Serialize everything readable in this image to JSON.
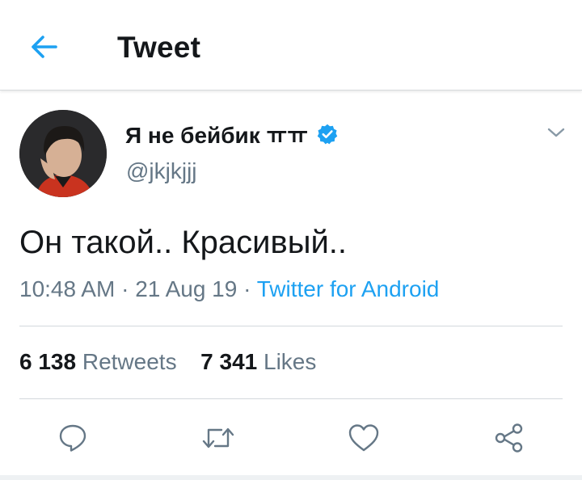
{
  "header": {
    "title": "Tweet",
    "back_icon": "arrow-left-icon",
    "accent": "#1da1f2"
  },
  "tweet": {
    "author": {
      "display_name": "Я не бейбик ㅠㅠ",
      "handle": "@jkjkjjj",
      "verified": true,
      "verified_color": "#1da1f2"
    },
    "text": "Он такой.. Красивый..",
    "time": "10:48 AM",
    "date": "21 Aug 19",
    "separator": "·",
    "source": "Twitter for Android",
    "stats": {
      "retweets_count": "6 138",
      "retweets_label": "Retweets",
      "likes_count": "7 341",
      "likes_label": "Likes"
    }
  },
  "actions": [
    "reply-icon",
    "retweet-icon",
    "like-icon",
    "share-icon"
  ],
  "colors": {
    "text_primary": "#14171a",
    "text_secondary": "#657786",
    "icon_gray": "#657786",
    "divider": "#d3d8dc"
  }
}
